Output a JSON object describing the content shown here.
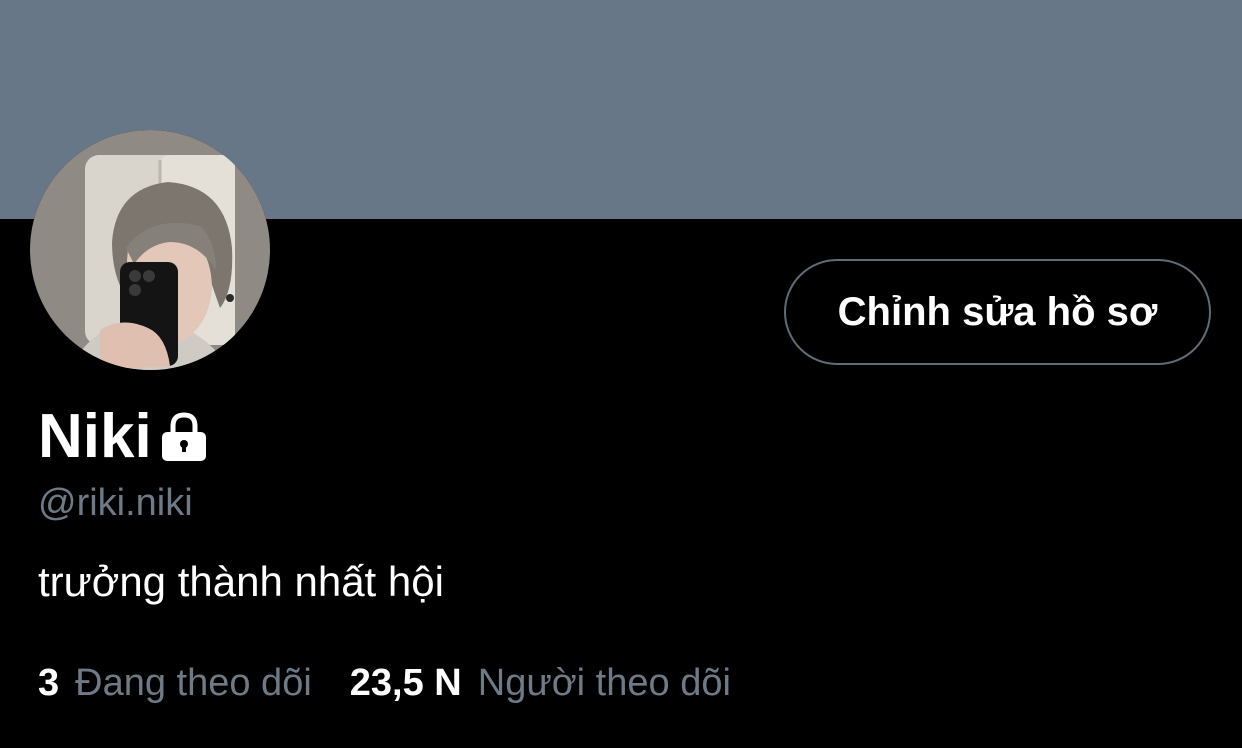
{
  "profile": {
    "edit_button_label": "Chỉnh sửa hồ sơ",
    "display_name": "Niki",
    "handle": "@riki.niki",
    "bio": "trưởng thành nhất hội",
    "locked": true
  },
  "stats": {
    "following_count": "3",
    "following_label": "Đang theo dõi",
    "followers_count": "23,5 N",
    "followers_label": "Người theo dõi"
  },
  "colors": {
    "banner": "#687787",
    "background": "#000000",
    "primary_text": "#ffffff",
    "secondary_text": "#6e7a86",
    "button_border": "#5f6b76"
  },
  "icons": {
    "lock": "lock-icon"
  }
}
